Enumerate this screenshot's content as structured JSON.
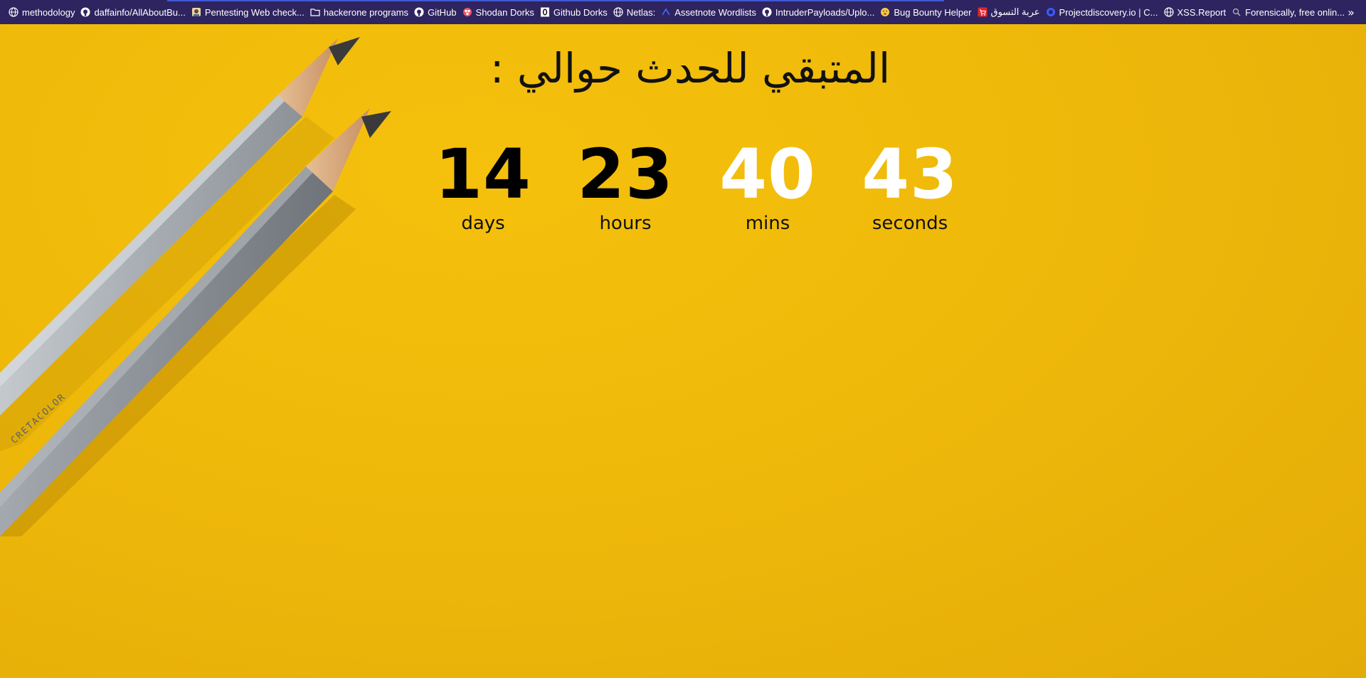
{
  "bookmarks": [
    {
      "label": "methodology",
      "icon": "globe-icon"
    },
    {
      "label": "daffainfo/AllAboutBu...",
      "icon": "github-icon"
    },
    {
      "label": "Pentesting Web check...",
      "icon": "hacker-avatar-icon"
    },
    {
      "label": "hackerone programs",
      "icon": "folder-icon"
    },
    {
      "label": "GitHub",
      "icon": "github-icon"
    },
    {
      "label": "Shodan Dorks",
      "icon": "shodan-icon"
    },
    {
      "label": "Github Dorks",
      "icon": "zero-icon"
    },
    {
      "label": "Netlas:",
      "icon": "globe-icon"
    },
    {
      "label": "Assetnote Wordlists",
      "icon": "assetnote-icon"
    },
    {
      "label": "IntruderPayloads/Uplo...",
      "icon": "github-icon"
    },
    {
      "label": "Bug Bounty Helper",
      "icon": "emoji-icon"
    },
    {
      "label": "عربة التسوق",
      "icon": "shopping-cart-icon"
    },
    {
      "label": "Projectdiscovery.io | C...",
      "icon": "projectdiscovery-icon"
    },
    {
      "label": "XSS.Report",
      "icon": "globe-icon"
    },
    {
      "label": "Forensically, free onlin...",
      "icon": "magnifier-icon"
    }
  ],
  "overflow": {
    "label": "»"
  },
  "countdown": {
    "heading": "المتبقي للحدث حوالي :",
    "units": [
      {
        "value": "14",
        "label": "days",
        "color": "#000000"
      },
      {
        "value": "23",
        "label": "hours",
        "color": "#000000"
      },
      {
        "value": "40",
        "label": "mins",
        "color": "#ffffff"
      },
      {
        "value": "43",
        "label": "seconds",
        "color": "#ffffff"
      }
    ]
  },
  "colors": {
    "bookmarks_bar": "#2e2460",
    "background": "#f2bd0b",
    "pencil_body": "#9a9fa6",
    "pencil_wood": "#d9a77a"
  }
}
